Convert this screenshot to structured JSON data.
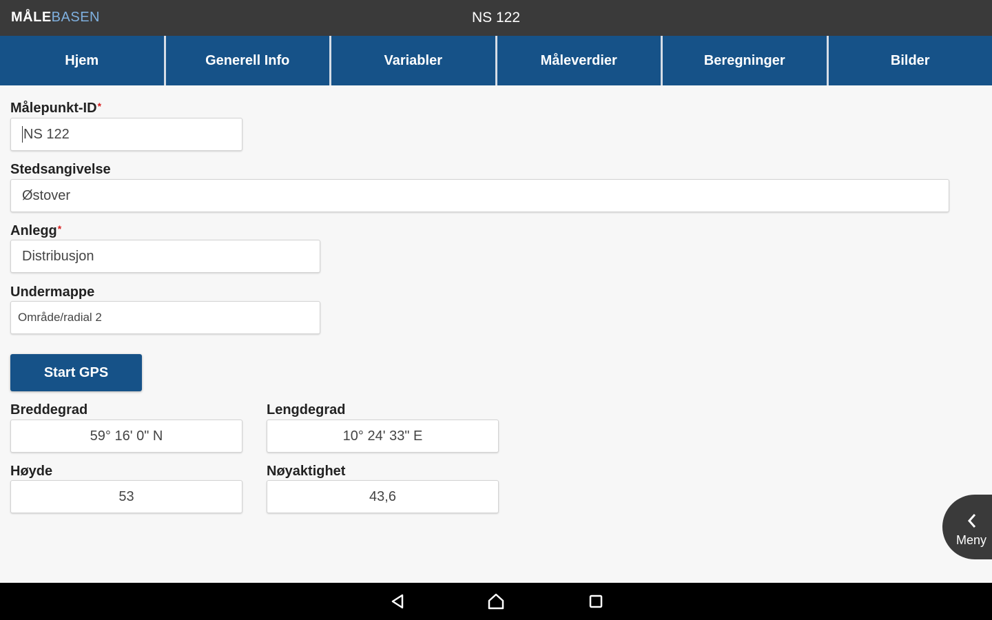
{
  "app": {
    "logo_part1": "MÅLE",
    "logo_part2": "BASEN",
    "screen_title": "NS 122"
  },
  "tabs": [
    {
      "label": "Hjem"
    },
    {
      "label": "Generell Info"
    },
    {
      "label": "Variabler"
    },
    {
      "label": "Måleverdier"
    },
    {
      "label": "Beregninger"
    },
    {
      "label": "Bilder"
    }
  ],
  "form": {
    "malepunkt": {
      "label": "Målepunkt-ID",
      "required_marker": "*",
      "value": "NS 122"
    },
    "stedsangivelse": {
      "label": "Stedsangivelse",
      "value": "Østover"
    },
    "anlegg": {
      "label": "Anlegg",
      "required_marker": "*",
      "value": "Distribusjon"
    },
    "undermappe": {
      "label": "Undermappe",
      "value": "Område/radial 2"
    }
  },
  "gps": {
    "start_label": "Start GPS",
    "breddegrad": {
      "label": "Breddegrad",
      "value": "59° 16' 0\" N"
    },
    "lengdegrad": {
      "label": "Lengdegrad",
      "value": "10° 24' 33\" E"
    },
    "hoyde": {
      "label": "Høyde",
      "value": "53"
    },
    "noyaktighet": {
      "label": "Nøyaktighet",
      "value": "43,6"
    }
  },
  "menu": {
    "label": "Meny",
    "icon": "chevron-left-icon"
  },
  "system_nav": {
    "icons": [
      "back-icon",
      "home-icon",
      "recents-icon"
    ]
  },
  "colors": {
    "topbar": "#3a3a3a",
    "tabbar": "#165288",
    "accent": "#165288",
    "required": "#d71f1f",
    "logo_accent": "#7fb0df"
  }
}
